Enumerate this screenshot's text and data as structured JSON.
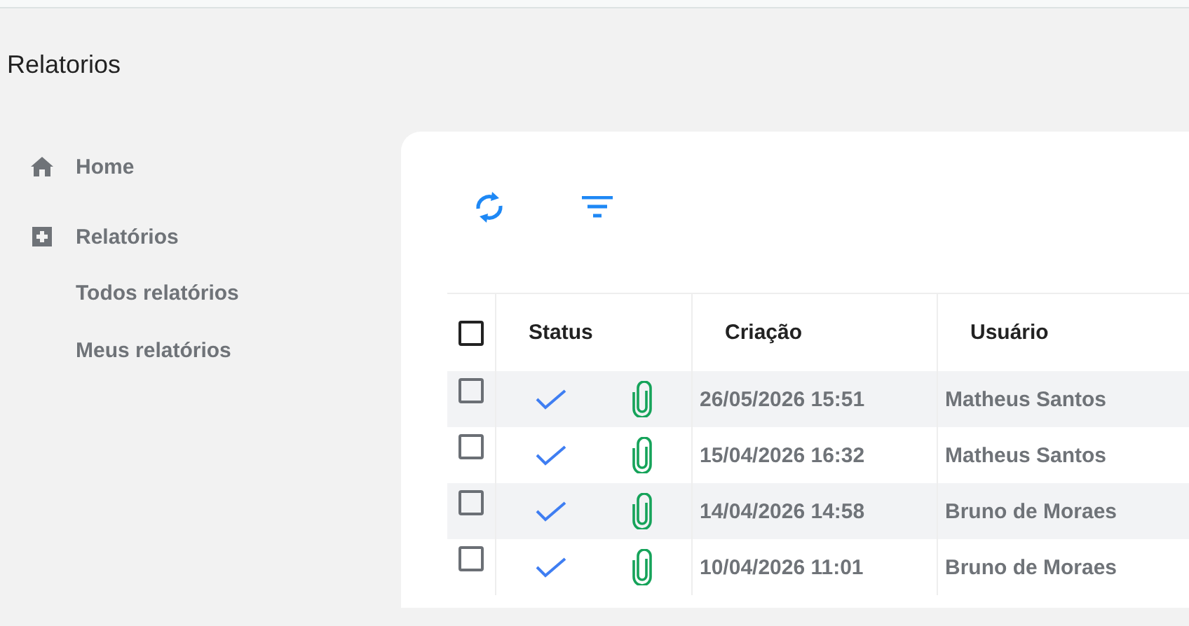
{
  "page": {
    "title": "Relatorios"
  },
  "sidebar": {
    "items": [
      {
        "label": "Home",
        "kind": "home"
      },
      {
        "label": "Relatórios",
        "kind": "reports",
        "children": [
          {
            "label": "Todos relatórios"
          },
          {
            "label": "Meus relatórios"
          }
        ]
      }
    ]
  },
  "table": {
    "select_all": {
      "checked": false
    },
    "columns": [
      "Status",
      "Criação",
      "Usuário"
    ],
    "rows": [
      {
        "checked": false,
        "completed": true,
        "has_attachment": true,
        "created": "26/05/2026 15:51",
        "user": "Matheus Santos"
      },
      {
        "checked": false,
        "completed": true,
        "has_attachment": true,
        "created": "15/04/2026 16:32",
        "user": "Matheus Santos"
      },
      {
        "checked": false,
        "completed": true,
        "has_attachment": true,
        "created": "14/04/2026 14:58",
        "user": "Bruno de Moraes"
      },
      {
        "checked": false,
        "completed": true,
        "has_attachment": true,
        "created": "10/04/2026 11:01",
        "user": "Bruno de Moraes"
      }
    ]
  }
}
